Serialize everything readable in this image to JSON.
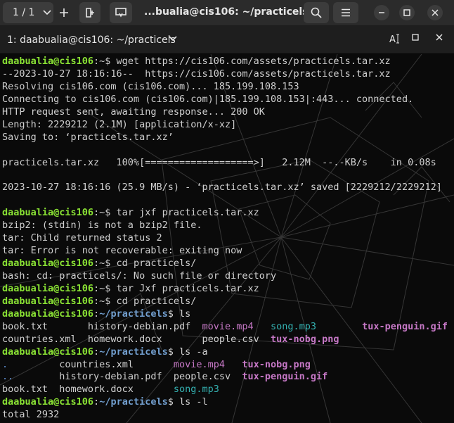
{
  "titlebar": {
    "tab_counter": "1 / 1",
    "title": "...bualia@cis106: ~/practicels"
  },
  "tab": {
    "label": "1: daabualia@cis106: ~/practicels"
  },
  "terminal": {
    "lines": [
      [
        {
          "t": "daabualia@cis106",
          "c": "user"
        },
        {
          "t": ":~$ wget https://cis106.com/assets/practicels.tar.xz"
        }
      ],
      [
        {
          "t": "--2023-10-27 18:16:16--  https://cis106.com/assets/practicels.tar.xz"
        }
      ],
      [
        {
          "t": "Resolving cis106.com (cis106.com)... 185.199.108.153"
        }
      ],
      [
        {
          "t": "Connecting to cis106.com (cis106.com)|185.199.108.153|:443... connected."
        }
      ],
      [
        {
          "t": "HTTP request sent, awaiting response... 200 OK"
        }
      ],
      [
        {
          "t": "Length: 2229212 (2.1M) [application/x-xz]"
        }
      ],
      [
        {
          "t": "Saving to: ‘practicels.tar.xz’"
        }
      ],
      [
        {
          "t": ""
        }
      ],
      [
        {
          "t": "practicels.tar.xz   100%[===================>]   2.12M  --.-KB/s    in 0.08s"
        }
      ],
      [
        {
          "t": ""
        }
      ],
      [
        {
          "t": "2023-10-27 18:16:16 (25.9 MB/s) - ‘practicels.tar.xz’ saved [2229212/2229212]"
        }
      ],
      [
        {
          "t": ""
        }
      ],
      [
        {
          "t": "daabualia@cis106",
          "c": "user"
        },
        {
          "t": ":~$ tar jxf practicels.tar.xz"
        }
      ],
      [
        {
          "t": "bzip2: (stdin) is not a bzip2 file."
        }
      ],
      [
        {
          "t": "tar: Child returned status 2"
        }
      ],
      [
        {
          "t": "tar: Error is not recoverable: exiting now"
        }
      ],
      [
        {
          "t": "daabualia@cis106",
          "c": "user"
        },
        {
          "t": ":~$ cd practicels/"
        }
      ],
      [
        {
          "t": "bash: cd: practicels/: No such file or directory"
        }
      ],
      [
        {
          "t": "daabualia@cis106",
          "c": "user"
        },
        {
          "t": ":~$ tar Jxf practicels.tar.xz"
        }
      ],
      [
        {
          "t": "daabualia@cis106",
          "c": "user"
        },
        {
          "t": ":~$ cd practicels/"
        }
      ],
      [
        {
          "t": "daabualia@cis106",
          "c": "user"
        },
        {
          "t": ":"
        },
        {
          "t": "~/practicels",
          "c": "path"
        },
        {
          "t": "$ ls"
        }
      ],
      [
        {
          "t": "book.txt       history-debian.pdf  "
        },
        {
          "t": "movie.mp4",
          "c": "mp4"
        },
        {
          "t": "   "
        },
        {
          "t": "song.mp3",
          "c": "cyan"
        },
        {
          "t": "        "
        },
        {
          "t": "tux-penguin.gif",
          "c": "gif"
        }
      ],
      [
        {
          "t": "countries.xml  homework.docx       people.csv  "
        },
        {
          "t": "tux-nobg.png",
          "c": "png"
        }
      ],
      [
        {
          "t": "daabualia@cis106",
          "c": "user"
        },
        {
          "t": ":"
        },
        {
          "t": "~/practicels",
          "c": "path"
        },
        {
          "t": "$ ls -a"
        }
      ],
      [
        {
          "t": ".",
          "c": "blue"
        },
        {
          "t": "         countries.xml       "
        },
        {
          "t": "movie.mp4",
          "c": "mp4"
        },
        {
          "t": "   "
        },
        {
          "t": "tux-nobg.png",
          "c": "png"
        }
      ],
      [
        {
          "t": "..",
          "c": "blue"
        },
        {
          "t": "        history-debian.pdf  people.csv  "
        },
        {
          "t": "tux-penguin.gif",
          "c": "gif"
        }
      ],
      [
        {
          "t": "book.txt  homework.docx       "
        },
        {
          "t": "song.mp3",
          "c": "cyan"
        }
      ],
      [
        {
          "t": "daabualia@cis106",
          "c": "user"
        },
        {
          "t": ":"
        },
        {
          "t": "~/practicels",
          "c": "path"
        },
        {
          "t": "$ ls -l"
        }
      ],
      [
        {
          "t": "total 2932"
        }
      ]
    ]
  }
}
